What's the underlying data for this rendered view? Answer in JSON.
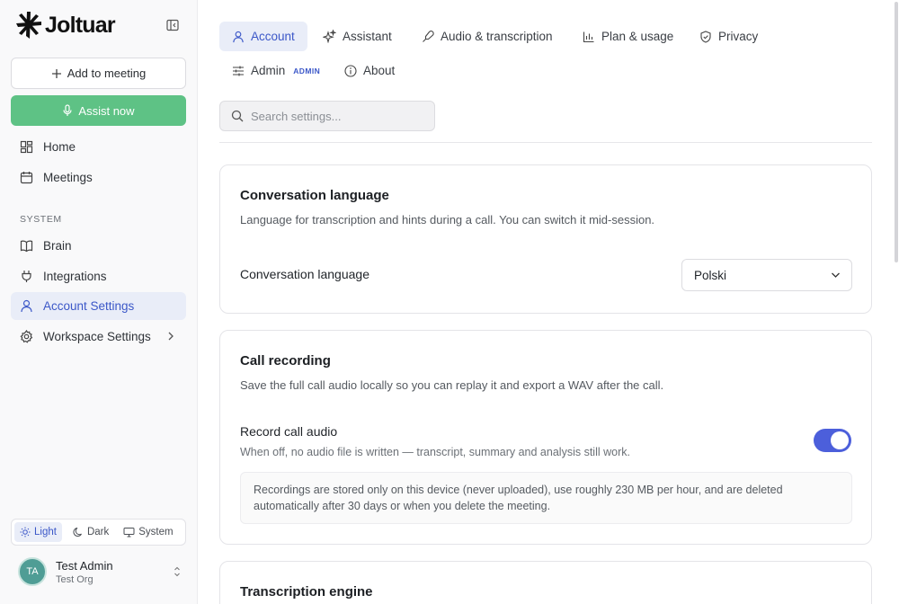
{
  "app": {
    "brand": "Joltuar"
  },
  "sidebar": {
    "add_to_meeting": "Add to meeting",
    "assist_now": "Assist now",
    "nav_top": [
      {
        "label": "Home",
        "icon": "home-grid-icon"
      },
      {
        "label": "Meetings",
        "icon": "calendar-icon"
      }
    ],
    "section_label": "SYSTEM",
    "nav_system": [
      {
        "label": "Brain",
        "icon": "book-icon"
      },
      {
        "label": "Integrations",
        "icon": "plug-icon"
      },
      {
        "label": "Account Settings",
        "icon": "user-icon",
        "active": true
      },
      {
        "label": "Workspace Settings",
        "icon": "gear-icon"
      }
    ],
    "theme": {
      "options": [
        "Light",
        "Dark",
        "System"
      ],
      "selected": "Light"
    },
    "user": {
      "initials": "TA",
      "name": "Test Admin",
      "org": "Test Org"
    }
  },
  "tabs": [
    {
      "label": "Account",
      "icon": "user-icon",
      "active": true
    },
    {
      "label": "Assistant",
      "icon": "sparkles-icon"
    },
    {
      "label": "Audio & transcription",
      "icon": "microphone-icon"
    },
    {
      "label": "Plan & usage",
      "icon": "bar-chart-icon"
    },
    {
      "label": "Privacy",
      "icon": "shield-icon"
    },
    {
      "label": "Admin",
      "icon": "sliders-icon",
      "badge": "ADMIN"
    },
    {
      "label": "About",
      "icon": "info-icon"
    }
  ],
  "search": {
    "placeholder": "Search settings...",
    "value": ""
  },
  "cards": {
    "conversation_language": {
      "title": "Conversation language",
      "description": "Language for transcription and hints during a call. You can switch it mid-session.",
      "row_label": "Conversation language",
      "selected": "Polski"
    },
    "call_recording": {
      "title": "Call recording",
      "description": "Save the full call audio locally so you can replay it and export a WAV after the call.",
      "row_label": "Record call audio",
      "row_sub": "When off, no audio file is written — transcript, summary and analysis still work.",
      "toggle_on": true,
      "note": "Recordings are stored only on this device (never uploaded), use roughly 230 MB per hour, and are deleted automatically after 30 days or when you delete the meeting."
    },
    "transcription_engine": {
      "title": "Transcription engine"
    }
  },
  "colors": {
    "accent": "#3b57c8",
    "accent_bg": "#e9edf8",
    "assist_green": "#5ec285",
    "toggle_on": "#4c5fdb"
  }
}
